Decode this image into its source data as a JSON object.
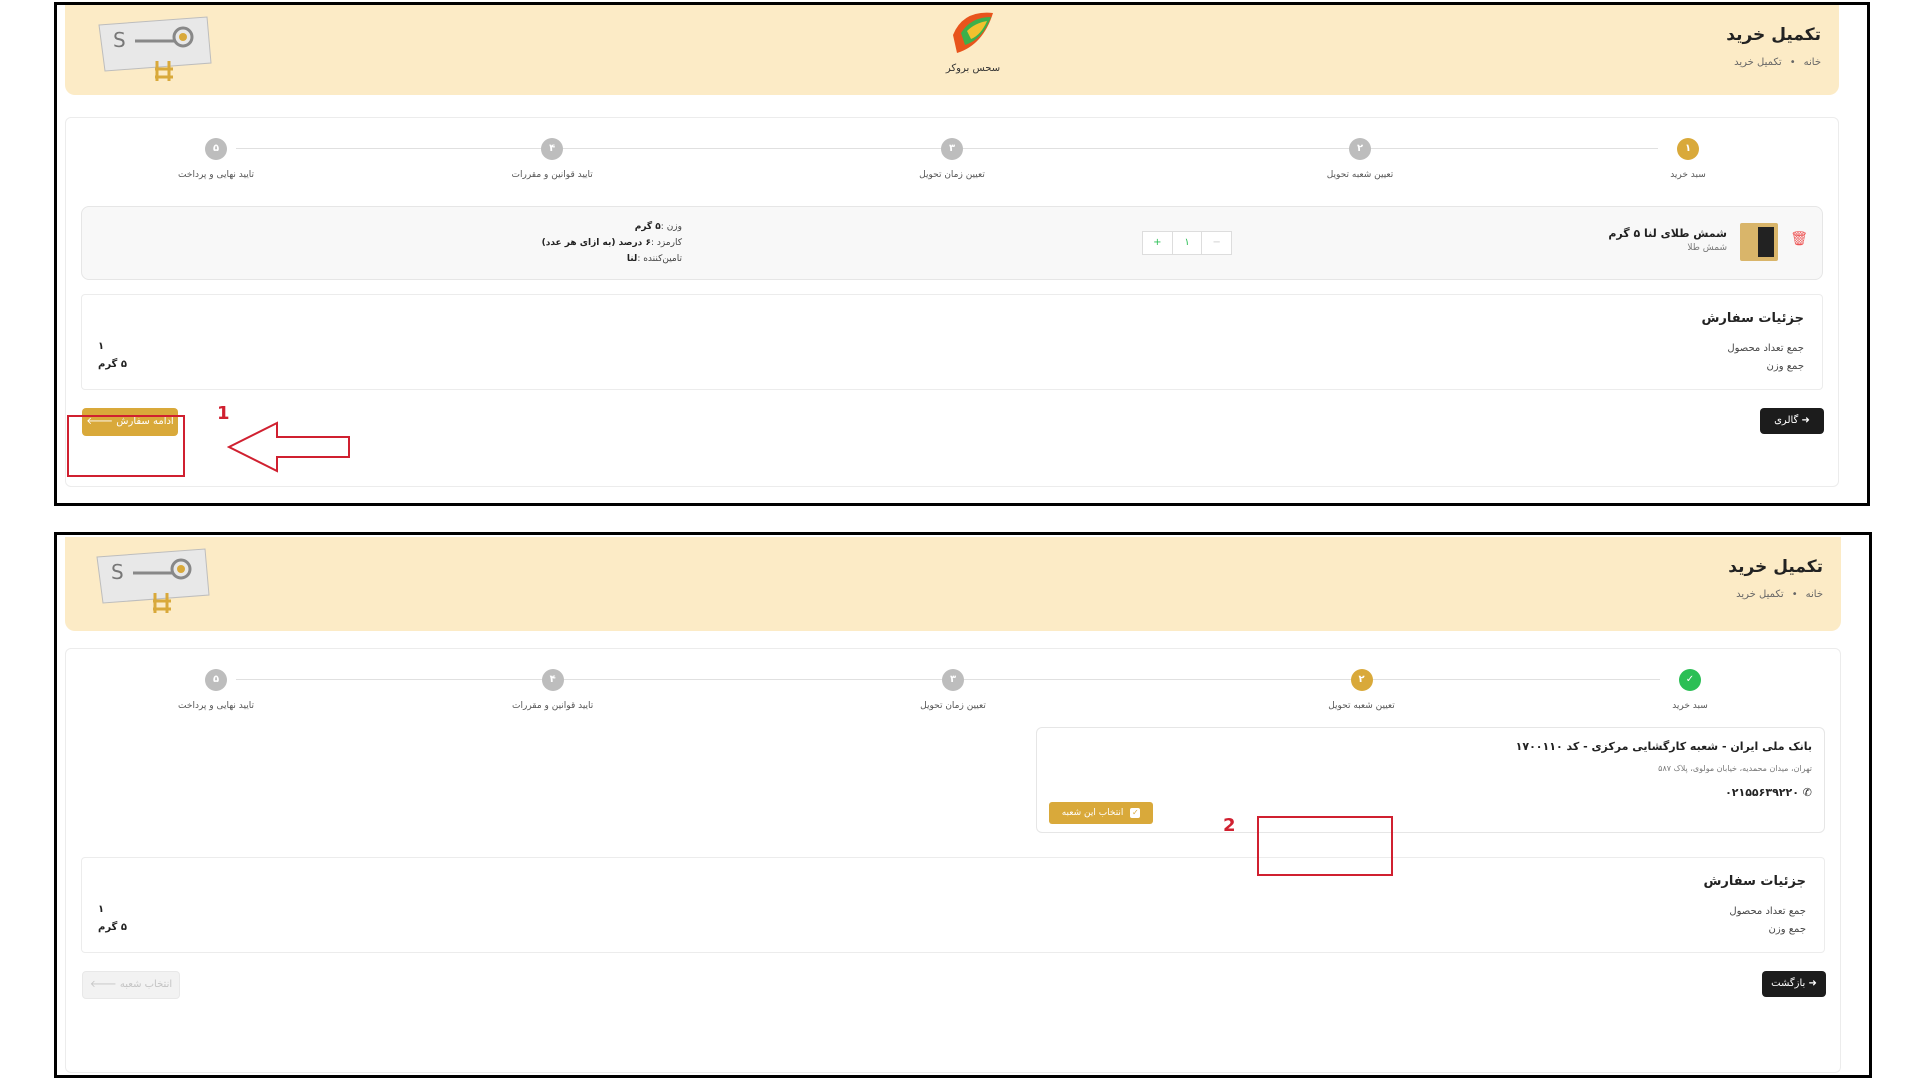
{
  "header": {
    "title": "تکمیل خرید",
    "crumb_home": "خانه",
    "crumb_current": "تکمیل خرید",
    "center_logo_caption": "سحس بروکر"
  },
  "stepper": [
    {
      "num": "۱",
      "label": "سبد خرید"
    },
    {
      "num": "۲",
      "label": "تعیین شعبه تحویل"
    },
    {
      "num": "۳",
      "label": "تعیین زمان تحویل"
    },
    {
      "num": "۴",
      "label": "تایید قوانین و مقررات"
    },
    {
      "num": "۵",
      "label": "تایید نهایی و پرداخت"
    }
  ],
  "panel1": {
    "product": {
      "name": "شمش طلای لنا ۵ گرم",
      "category": "شمش طلا",
      "qty": "۱",
      "plus": "+",
      "minus": "−",
      "weight_label": "وزن :",
      "weight_value": "۵ گرم",
      "fee_label": "کارمزد :",
      "fee_value": "۶ درصد (به ازای هر عدد)",
      "supplier_label": "تامین‌کننده :",
      "supplier_value": "لنا"
    },
    "details": {
      "title": "جزئیات سفارش",
      "count_label": "جمع تعداد محصول",
      "weight_label": "جمع وزن",
      "count_value": "۱",
      "weight_value": "۵ گرم"
    },
    "back_button": "گالری",
    "continue_button": "ادامه سفارش",
    "annotation": "1"
  },
  "panel2": {
    "branch": {
      "name": "بانک ملی ایران - شعبه کارگشایی مرکزی - کد ۱۷۰۰۱۱۰",
      "address": "تهران، میدان محمدیه، خیابان مولوی، پلاک ۵۸۷",
      "phone": "۰۲۱۵۵۶۳۹۲۲۰",
      "select_button": "انتخاب این شعبه"
    },
    "details": {
      "title": "جزئیات سفارش",
      "count_label": "جمع تعداد محصول",
      "weight_label": "جمع وزن",
      "count_value": "۱",
      "weight_value": "۵ گرم"
    },
    "back_button": "بازگشت",
    "next_button": "انتخاب شعبه",
    "annotation": "2"
  },
  "colors": {
    "header_bg": "#fcebc6",
    "gold": "#d9a93a",
    "success": "#2bbf55",
    "annotation_red": "#d02030"
  }
}
